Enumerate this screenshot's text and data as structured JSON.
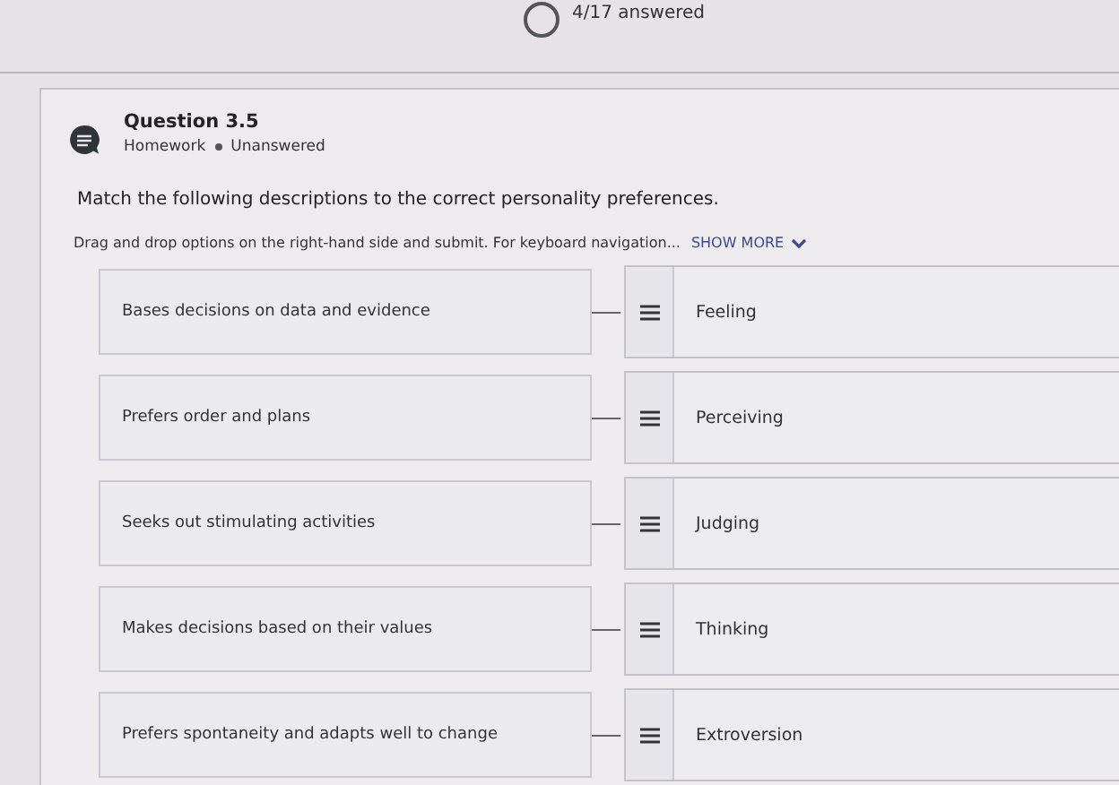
{
  "header": {
    "progress": "4/17 answered"
  },
  "question": {
    "title": "Question 3.5",
    "type": "Homework",
    "status": "Unanswered",
    "prompt": "Match the following descriptions to the correct personality preferences.",
    "instructions": "Drag and drop options on the right-hand side and submit. For keyboard navigation...",
    "show_more": "SHOW MORE"
  },
  "pairs": [
    {
      "description": "Bases decisions on data and evidence",
      "option": "Feeling"
    },
    {
      "description": "Prefers order and plans",
      "option": "Perceiving"
    },
    {
      "description": "Seeks out stimulating activities",
      "option": "Judging"
    },
    {
      "description": "Makes decisions based on their values",
      "option": "Thinking"
    },
    {
      "description": "Prefers spontaneity and adapts well to change",
      "option": "Extroversion"
    }
  ]
}
